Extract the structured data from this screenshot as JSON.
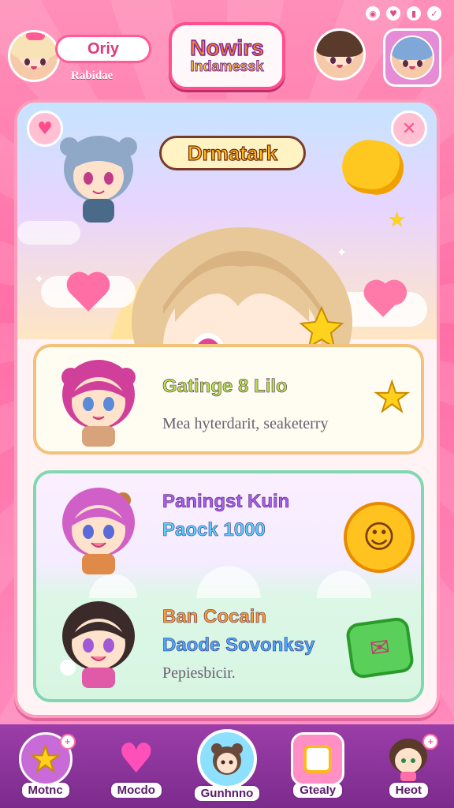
{
  "status_bar": {
    "icons": [
      "signal-icon",
      "heart-icon",
      "battery-icon",
      "check-icon"
    ]
  },
  "header": {
    "player_name": "Oriy",
    "player_subtitle": "Rabidae",
    "title_line1": "Nowirs",
    "title_line2": "Indamessk"
  },
  "hero": {
    "title": "Drmatark",
    "left_button_icon": "heart-icon",
    "right_button_icon": "close-icon"
  },
  "cards": [
    {
      "title": "Gatinge 8 Lilo",
      "title_color": "#b8e04a",
      "desc": "Mea hyterdarit, seaketerry",
      "reward_icon": "star-icon"
    },
    {
      "title": "Paningst Kuin",
      "title_color": "#a85cf0",
      "subtitle": "Paock 1000",
      "subtitle_color": "#5ad0ff",
      "reward_icon": "smiley-coin-icon"
    },
    {
      "title": "Ban Cocain",
      "title_color": "#ff9a2e",
      "subtitle": "Daode Sovonksy",
      "subtitle_color": "#4aa8ff",
      "desc": "Pepiesbicir.",
      "reward_icon": "green-gift-icon"
    }
  ],
  "nav": [
    {
      "label": "Motnc",
      "icon": "star-icon",
      "badge": "+",
      "active": false
    },
    {
      "label": "Mocdo",
      "icon": "heart-icon",
      "badge": "",
      "active": false
    },
    {
      "label": "Gunhnno",
      "icon": "bear-avatar-icon",
      "badge": "",
      "active": true
    },
    {
      "label": "Gtealy",
      "icon": "photo-frame-icon",
      "badge": "",
      "active": false
    },
    {
      "label": "Heot",
      "icon": "profile-avatar-icon",
      "badge": "+",
      "active": false
    }
  ],
  "colors": {
    "accent": "#ff6fa6",
    "nav_bg": "#8b339b",
    "panel_border": "#ff9cbd"
  }
}
